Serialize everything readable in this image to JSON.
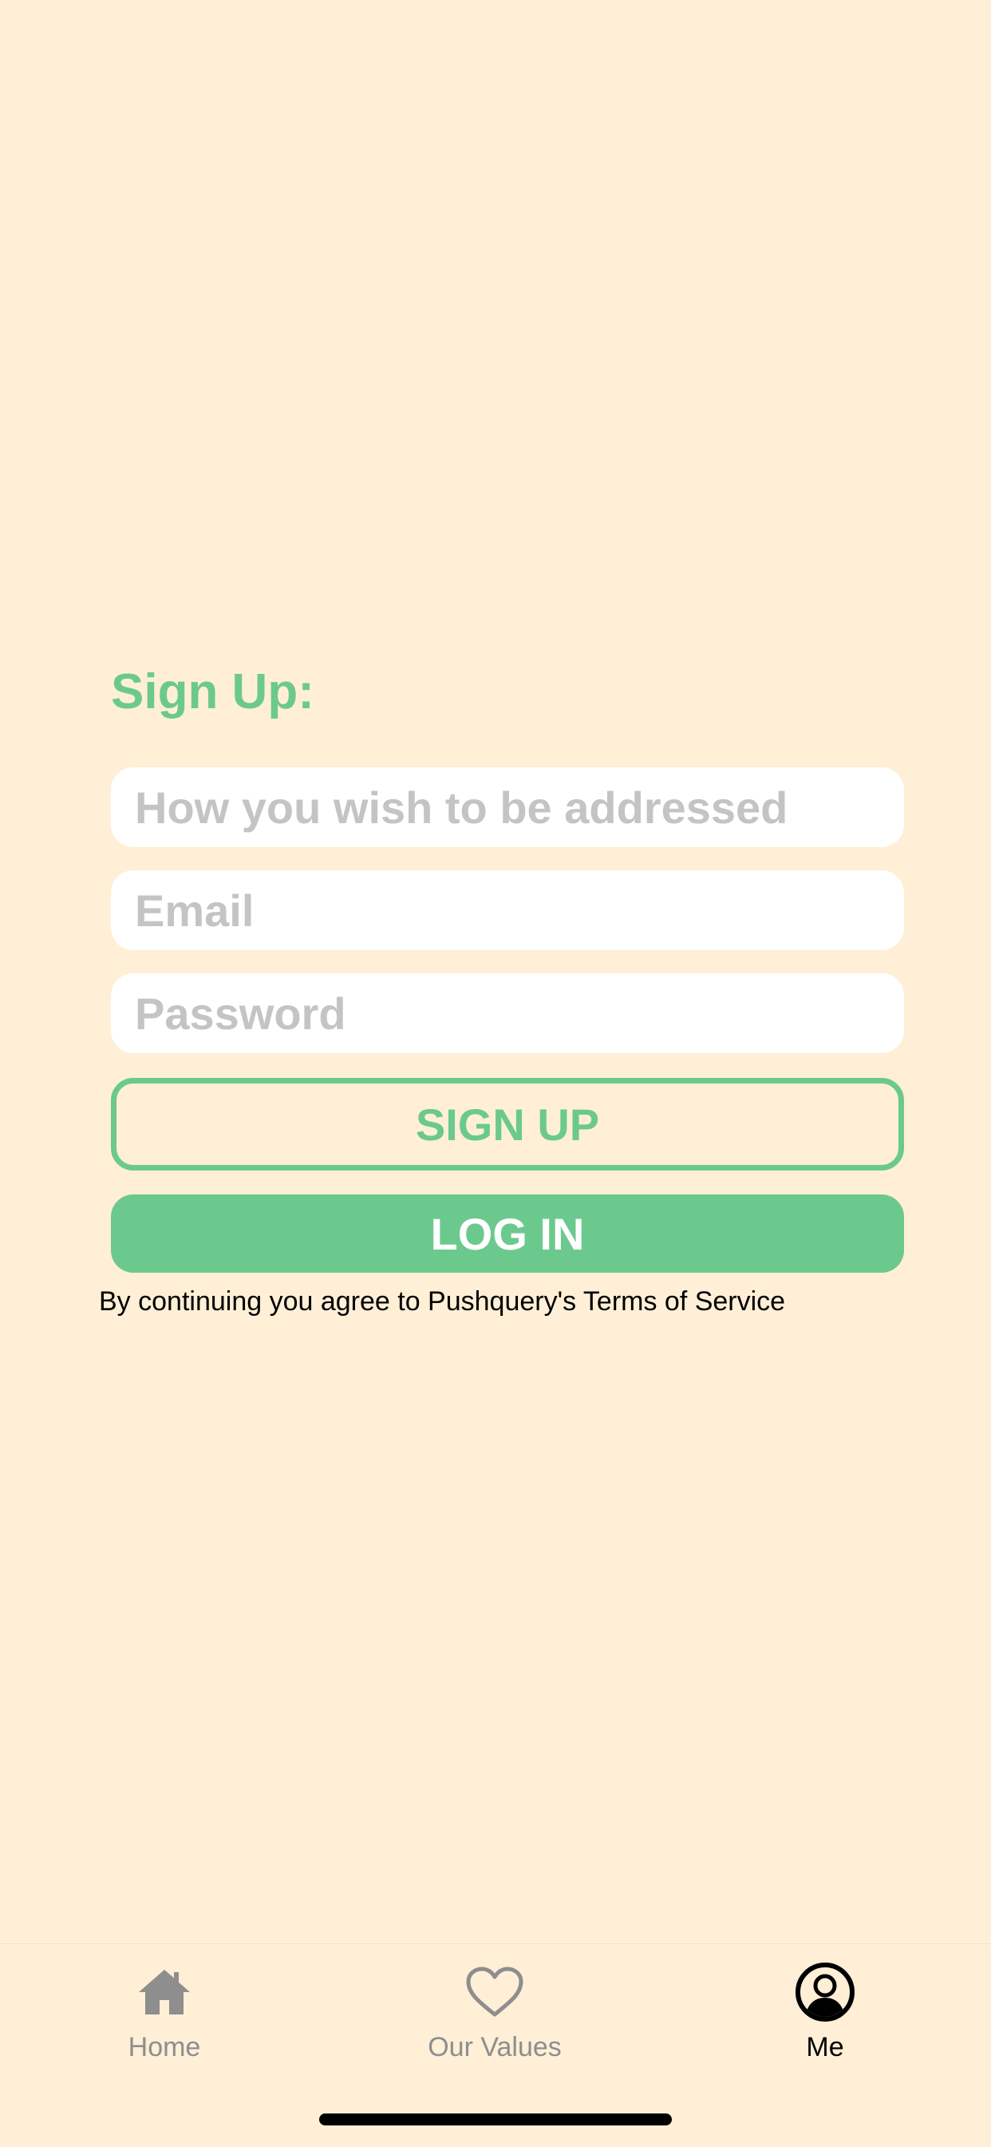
{
  "signup": {
    "title": "Sign Up:",
    "name_placeholder": "How you wish to be addressed",
    "email_placeholder": "Email",
    "password_placeholder": "Password",
    "signup_button": "SIGN UP",
    "login_button": "LOG IN",
    "terms_text": "By continuing you agree to Pushquery's Terms of Service"
  },
  "tabbar": {
    "items": [
      {
        "label": "Home",
        "icon": "home-icon",
        "active": false
      },
      {
        "label": "Our Values",
        "icon": "heart-icon",
        "active": false
      },
      {
        "label": "Me",
        "icon": "user-icon",
        "active": true
      }
    ]
  },
  "colors": {
    "background": "#FEEFD6",
    "accent": "#6CC98E",
    "placeholder": "#C4C4C4",
    "inactive_tab": "#8E8E8E",
    "active_tab": "#000000"
  }
}
